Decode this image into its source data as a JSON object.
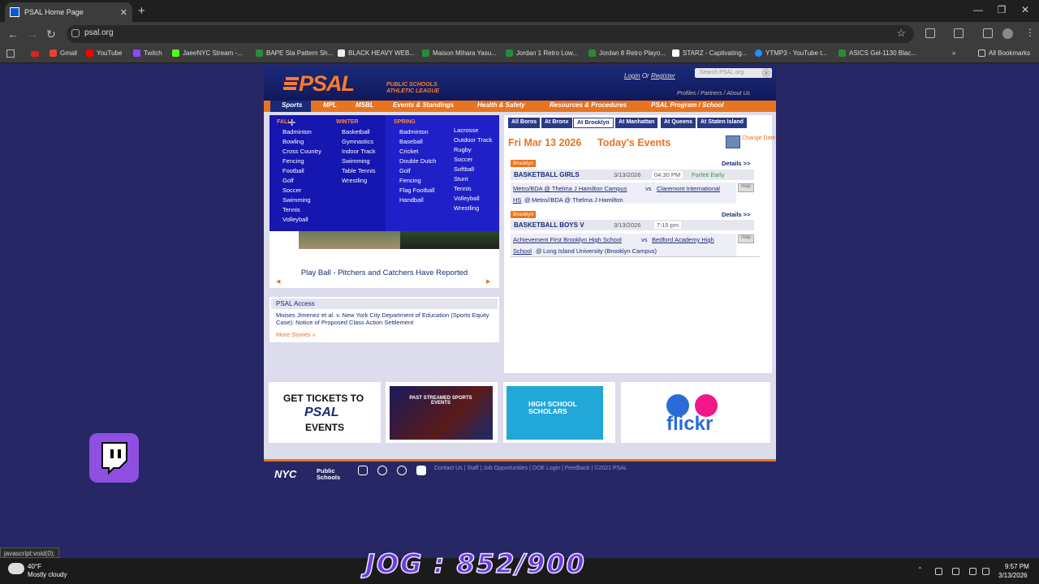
{
  "browser": {
    "tab_title": "PSAL Home Page",
    "url": "psal.org",
    "bookmarks": [
      "Gmail",
      "YouTube",
      "Twitch",
      "JaeeNYC Stream -...",
      "BAPE Sta Pattern Sh...",
      "BLACK HEAVY WEB...",
      "Maison Mihara Yasu...",
      "Jordan 1 Retro Low...",
      "Jordan 8 Retro Playo...",
      "STARZ - Captivating...",
      "YTMP3 - YouTube t...",
      "ASICS Gel-1130 Blac..."
    ],
    "all_bookmarks": "All Bookmarks",
    "status_url": "javascript:void(0);"
  },
  "header": {
    "logo": "PSAL",
    "logo_sub1": "PUBLIC SCHOOLS",
    "logo_sub2": "ATHLETIC LEAGUE",
    "login": "Login",
    "or": "Or",
    "register": "Register",
    "search_placeholder": "Search PSAL.org",
    "util_links": "Profiles  /  Partners  /  About Us"
  },
  "nav": [
    "Sports",
    "MPL",
    "MSBL",
    "Events & Standings",
    "Health & Safety",
    "Resources & Procedures",
    "PSAL Program / School"
  ],
  "sports_menu": {
    "fall_label": "FALL",
    "winter_label": "WINTER",
    "spring_label": "SPRING",
    "fall": [
      "Badminton",
      "Bowling",
      "Cross Country",
      "Fencing",
      "Football",
      "Golf",
      "Soccer",
      "Swimming",
      "Tennis",
      "Volleyball"
    ],
    "winter": [
      "Basketball",
      "Gymnastics",
      "Indoor Track",
      "Swimming",
      "Table Tennis",
      "Wrestling"
    ],
    "spring1": [
      "Badminton",
      "Baseball",
      "Cricket",
      "Double Dutch",
      "Golf",
      "Fencing",
      "Flag Football",
      "Handball"
    ],
    "spring2": [
      "Lacrosse",
      "Outdoor Track",
      "Rugby",
      "Soccer",
      "Softball",
      "Stunt",
      "Tennis",
      "Volleyball",
      "Wrestling"
    ]
  },
  "carousel": {
    "title": "Play Ball - Pitchers and Catchers Have Reported"
  },
  "access": {
    "heading": "PSAL Access",
    "story": "Moises Jimenez et al. v. New York City Department of Education (Sports Equity Case): Notice of Proposed Class Action Settlement",
    "more": "More Stories »"
  },
  "events": {
    "tabs": [
      "All Boros",
      "At Bronx",
      "At Brooklyn",
      "At Manhattan",
      "At Queens",
      "At Staten Island"
    ],
    "active_tab": "At Brooklyn",
    "date": "Fri Mar 13 2026",
    "today": "Today's Events",
    "change_date": "Change Date",
    "items": [
      {
        "borough": "Brooklyn",
        "details": "Details >>",
        "sport": "BASKETBALL GIRLS",
        "date": "3/13/2026",
        "time": "04:30 PM",
        "status": "Forfeit Early",
        "home": "Metro/BDA @ Thelma J Hamilton Campus",
        "vs": "vs",
        "away": "Claremont International",
        "away2": "HS",
        "at": "@",
        "venue": "Metro//BDA @ Thelma J Hamilton",
        "map": "map"
      },
      {
        "borough": "Brooklyn",
        "details": "Details >>",
        "sport": "BASKETBALL BOYS V",
        "date": "3/13/2026",
        "time": "7:15 pm",
        "status": "",
        "home": "Achievement First Brooklyn High School",
        "vs": "vs",
        "away": "Bedford Academy High",
        "away2": "School",
        "at": "@",
        "venue": "Long Island University (Brooklyn Campus)",
        "map": "map"
      }
    ]
  },
  "promos": {
    "tix1": "GET TICKETS TO",
    "tix2": "PSAL",
    "tix3": "EVENTS",
    "stream": "PAST STREAMED SPORTS EVENTS",
    "hss1": "HIGH SCHOOL",
    "hss2": "SCHOLARS",
    "flickr": "flickr"
  },
  "footer": {
    "nyc": "NYC",
    "nyc2a": "Public",
    "nyc2b": "Schools",
    "links": "Contact Us  |  Staff  |  Job Opportunities  |  DOE Login  |  Feedback  |  ©2021 PSAL"
  },
  "taskbar": {
    "temp": "40°F",
    "weather": "Mostly cloudy",
    "time": "9:57 PM",
    "date": "3/13/2026"
  },
  "overlay": {
    "jog": "JOG : 852/900"
  }
}
